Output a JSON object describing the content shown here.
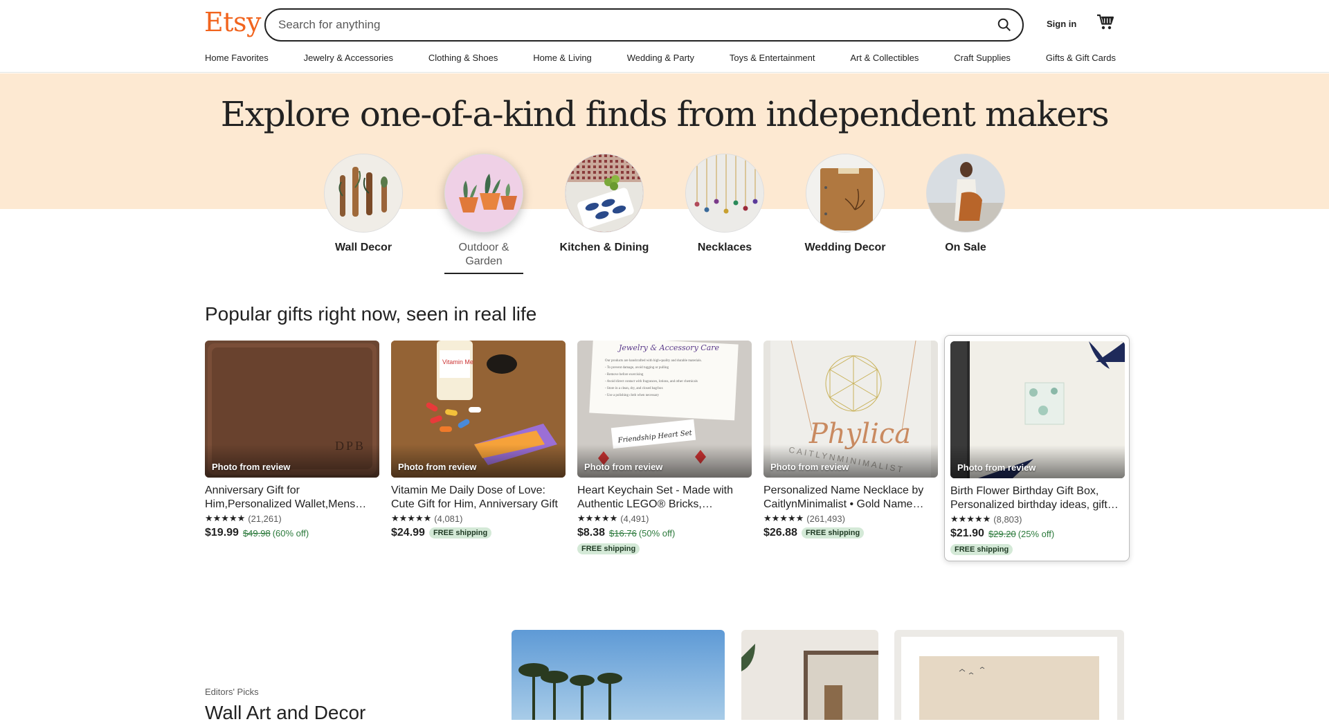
{
  "header": {
    "logo": "Etsy",
    "search_placeholder": "Search for anything",
    "signin": "Sign in",
    "categories": [
      "Home Favorites",
      "Jewelry & Accessories",
      "Clothing & Shoes",
      "Home & Living",
      "Wedding & Party",
      "Toys & Entertainment",
      "Art & Collectibles",
      "Craft Supplies",
      "Gifts & Gift Cards"
    ]
  },
  "hero": {
    "title": "Explore one-of-a-kind finds from independent makers",
    "circles": [
      {
        "label": "Wall Decor"
      },
      {
        "label": "Outdoor & Garden"
      },
      {
        "label": "Kitchen & Dining"
      },
      {
        "label": "Necklaces"
      },
      {
        "label": "Wedding Decor"
      },
      {
        "label": "On Sale"
      }
    ]
  },
  "popular": {
    "title": "Popular gifts right now, seen in real life",
    "badge": "Photo from review",
    "items": [
      {
        "title": "Anniversary Gift for Him,Personalized Wallet,Mens Leather Wallet",
        "stars": "★★★★★",
        "reviews": "(21,261)",
        "price": "$19.99",
        "old_price": "$49.98",
        "discount": "(60% off)",
        "free_shipping": ""
      },
      {
        "title": "Vitamin Me Daily Dose of Love: Cute Gift for Him, Anniversary Gift",
        "stars": "★★★★★",
        "reviews": "(4,081)",
        "price": "$24.99",
        "old_price": "",
        "discount": "",
        "free_shipping": "FREE shipping"
      },
      {
        "title": "Heart Keychain Set - Made with Authentic LEGO® Bricks, Friendship",
        "stars": "★★★★★",
        "reviews": "(4,491)",
        "price": "$8.38",
        "old_price": "$16.76",
        "discount": "(50% off)",
        "free_shipping": "FREE shipping"
      },
      {
        "title": "Personalized Name Necklace by CaitlynMinimalist • Gold Name Necklace",
        "stars": "★★★★★",
        "reviews": "(261,493)",
        "price": "$26.88",
        "old_price": "",
        "discount": "",
        "free_shipping": "FREE shipping"
      },
      {
        "title": "Birth Flower Birthday Gift Box, Personalized birthday ideas, gift box",
        "stars": "★★★★★",
        "reviews": "(8,803)",
        "price": "$21.90",
        "old_price": "$29.20",
        "discount": "(25% off)",
        "free_shipping": "FREE shipping"
      }
    ]
  },
  "editors": {
    "label": "Editors' Picks",
    "title": "Wall Art and Decor"
  },
  "colors": {
    "brand": "#f1641e",
    "hero_bg": "#fde9d2",
    "sale_green": "#2c7a3c",
    "free_badge": "#d4e9d7"
  }
}
